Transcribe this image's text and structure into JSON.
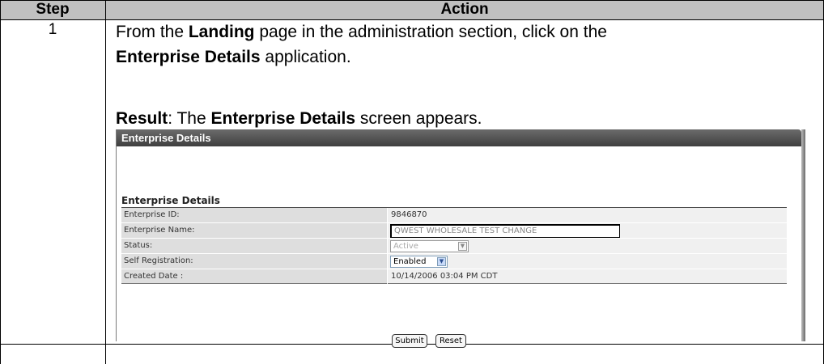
{
  "table": {
    "col_step": "Step",
    "col_action": "Action"
  },
  "row1": {
    "step": "1",
    "line1_pre": "From the ",
    "line1_bold": "Landing",
    "line1_post": " page in the administration section, click on the",
    "line2_bold": "Enterprise Details",
    "line2_post": " application.",
    "result_label": "Result",
    "result_pre": ":  The ",
    "result_bold": "Enterprise Details",
    "result_post": " screen appears."
  },
  "screenshot": {
    "window_title": "Enterprise Details",
    "section_title": "Enterprise Details",
    "fields": [
      {
        "label": "Enterprise ID:",
        "value": "9846870"
      },
      {
        "label": "Enterprise Name:",
        "value": "QWEST WHOLESALE TEST CHANGE"
      },
      {
        "label": "Status:",
        "value": "Active"
      },
      {
        "label": "Self Registration:",
        "value": "Enabled"
      },
      {
        "label": "Created Date :",
        "value": "10/14/2006 03:04 PM CDT"
      }
    ],
    "submit_label": "Submit",
    "reset_label": "Reset"
  },
  "row2": {
    "step": "",
    "action": ""
  }
}
